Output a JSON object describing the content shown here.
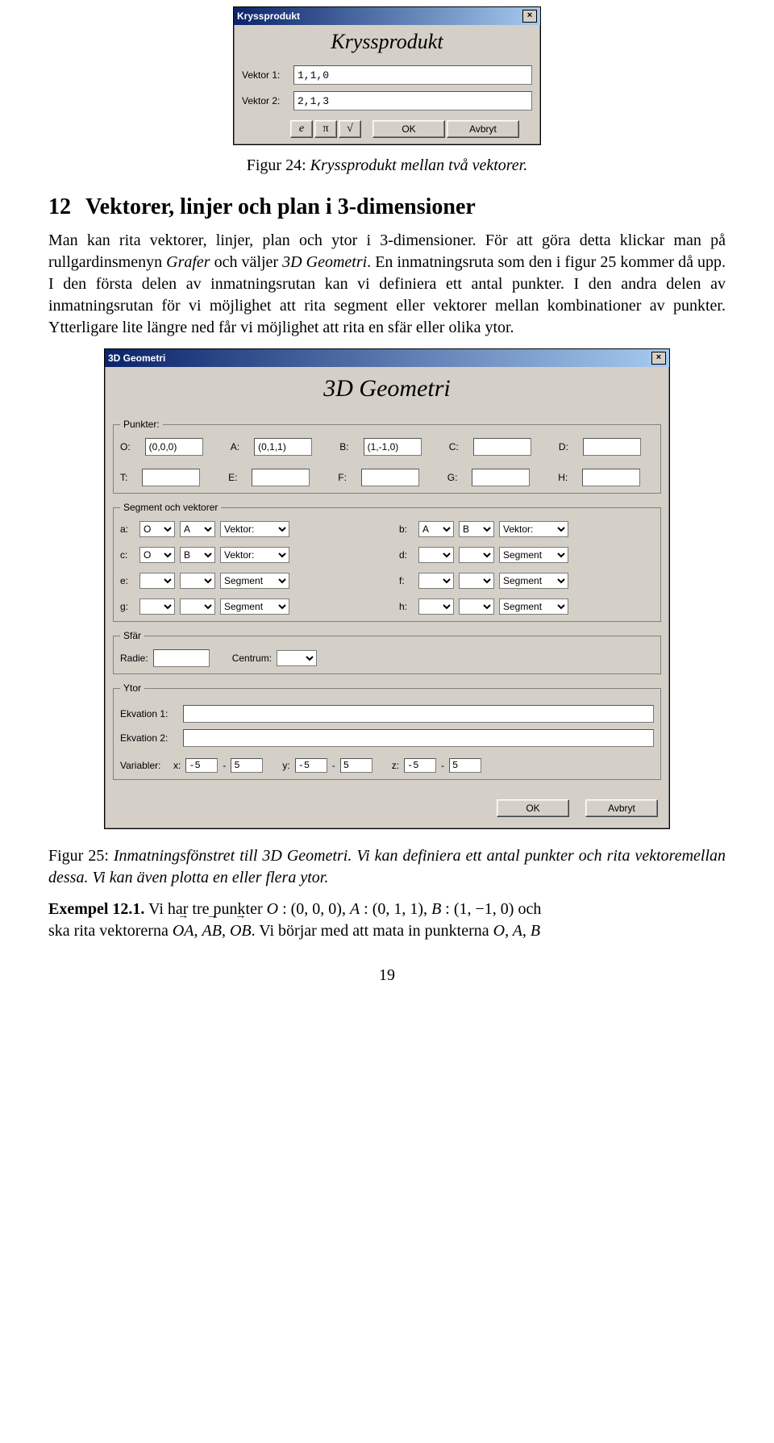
{
  "dialog1": {
    "title": "Kryssprodukt",
    "heading": "Kryssprodukt",
    "vektor1_label": "Vektor 1:",
    "vektor1_value": "1,1,0",
    "vektor2_label": "Vektor 2:",
    "vektor2_value": "2,1,3",
    "btn_e": "e",
    "btn_pi": "π",
    "btn_sqrt": "√",
    "btn_ok": "OK",
    "btn_cancel": "Avbryt",
    "close": "×"
  },
  "fig24": {
    "label": "Figur 24:",
    "text": "Kryssprodukt mellan två vektorer."
  },
  "section12": {
    "num": "12",
    "title": "Vektorer, linjer och plan i 3-dimensioner"
  },
  "para1": "Man kan rita vektorer, linjer, plan och ytor i 3-dimensioner. För att göra detta klickar man på rullgardinsmenyn Grafer och väljer 3D Geometri. En inmatningsruta som den i figur 25 kommer då upp. I den första delen av inmatningsrutan kan vi definiera ett antal punkter. I den andra delen av inmatningsrutan för vi möjlighet att rita segment eller vektorer mellan kombinationer av punkter. Ytterligare lite längre ned får vi möjlighet att rita en sfär eller olika ytor.",
  "dialog2": {
    "title": "3D Geometri",
    "heading": "3D Geometri",
    "close": "×",
    "grp_punkter": "Punkter:",
    "pts_row1": [
      {
        "lbl": "O:",
        "val": "(0,0,0)"
      },
      {
        "lbl": "A:",
        "val": "(0,1,1)"
      },
      {
        "lbl": "B:",
        "val": "(1,-1,0)"
      },
      {
        "lbl": "C:",
        "val": ""
      },
      {
        "lbl": "D:",
        "val": ""
      }
    ],
    "pts_row2": [
      {
        "lbl": "T:",
        "val": ""
      },
      {
        "lbl": "E:",
        "val": ""
      },
      {
        "lbl": "F:",
        "val": ""
      },
      {
        "lbl": "G:",
        "val": ""
      },
      {
        "lbl": "H:",
        "val": ""
      }
    ],
    "grp_seg": "Segment och vektorer",
    "type_vektor": "Vektor:",
    "type_segment": "Segment",
    "seg": [
      {
        "lbl": "a:",
        "p1": "O",
        "p2": "A",
        "type": "Vektor:"
      },
      {
        "lbl": "b:",
        "p1": "A",
        "p2": "B",
        "type": "Vektor:"
      },
      {
        "lbl": "c:",
        "p1": "O",
        "p2": "B",
        "type": "Vektor:"
      },
      {
        "lbl": "d:",
        "p1": "",
        "p2": "",
        "type": "Segment"
      },
      {
        "lbl": "e:",
        "p1": "",
        "p2": "",
        "type": "Segment"
      },
      {
        "lbl": "f:",
        "p1": "",
        "p2": "",
        "type": "Segment"
      },
      {
        "lbl": "g:",
        "p1": "",
        "p2": "",
        "type": "Segment"
      },
      {
        "lbl": "h:",
        "p1": "",
        "p2": "",
        "type": "Segment"
      }
    ],
    "grp_sfar": "Sfär",
    "radie_lbl": "Radie:",
    "radie_val": "",
    "centrum_lbl": "Centrum:",
    "centrum_val": "",
    "grp_ytor": "Ytor",
    "ekv1_lbl": "Ekvation 1:",
    "ekv1_val": "",
    "ekv2_lbl": "Ekvation 2:",
    "ekv2_val": "",
    "var_lbl": "Variabler:",
    "x_lbl": "x:",
    "x_lo": "-5",
    "x_hi": "5",
    "y_lbl": "y:",
    "y_lo": "-5",
    "y_hi": "5",
    "z_lbl": "z:",
    "z_lo": "-5",
    "z_hi": "5",
    "dash": "-",
    "btn_ok": "OK",
    "btn_cancel": "Avbryt"
  },
  "fig25": {
    "label": "Figur 25:",
    "text": "Inmatningsfönstret till 3D Geometri. Vi kan definiera ett antal punkter och rita vektoremellan dessa. Vi kan även plotta en eller flera ytor."
  },
  "example": {
    "label": "Exempel 12.1.",
    "line1a": "Vi har tre punkter ",
    "O": "O",
    "Oc": " : (0, 0, 0), ",
    "A": "A",
    "Ac": " : (0, 1, 1), ",
    "B": "B",
    "Bc": " : (1, −1, 0) och",
    "line2a": "ska rita vektorerna ",
    "v1": "OA",
    "c1": ", ",
    "v2": "AB",
    "c2": ", ",
    "v3": "OB",
    "line2b": ". Vi börjar med att mata in punkterna ",
    "pts": "O, A, B"
  },
  "pagenum": "19"
}
